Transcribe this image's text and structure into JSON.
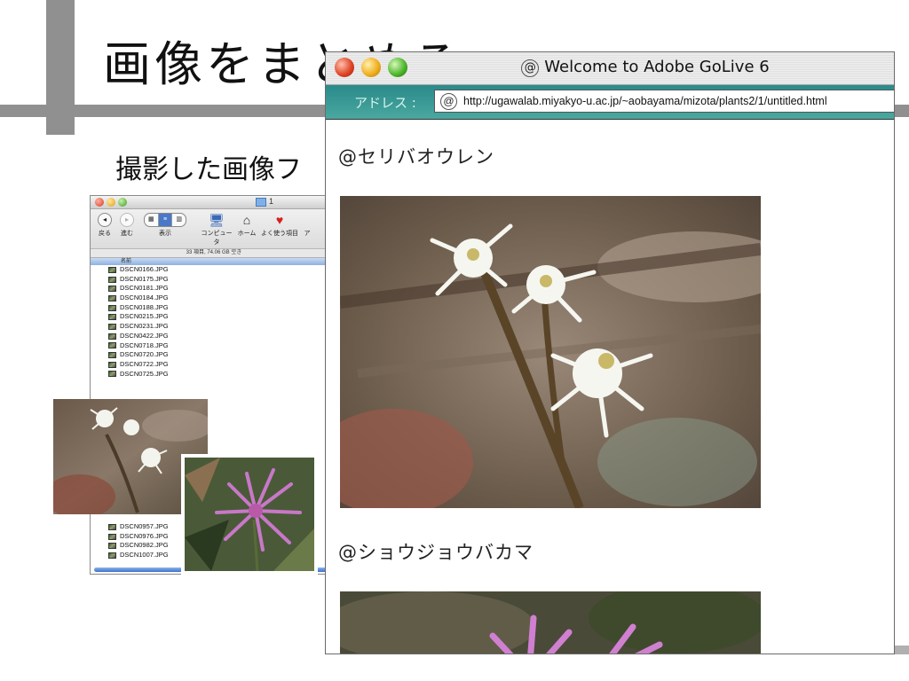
{
  "slide": {
    "title": "画像をまとめる",
    "subtitle": "撮影した画像フ"
  },
  "finder": {
    "title": "1",
    "toolbar": {
      "back": "戻る",
      "forward": "進む",
      "view": "表示",
      "computer": "コンピュータ",
      "home": "ホーム",
      "favorites": "よく使う項目",
      "applications": "ア"
    },
    "status": "33 項目, 74.06 GB 空き",
    "column_name": "名前",
    "files_top": [
      "DSCN0166.JPG",
      "DSCN0175.JPG",
      "DSCN0181.JPG",
      "DSCN0184.JPG",
      "DSCN0188.JPG",
      "DSCN0215.JPG",
      "DSCN0231.JPG",
      "DSCN0422.JPG",
      "DSCN0718.JPG",
      "DSCN0720.JPG",
      "DSCN0722.JPG",
      "DSCN0725.JPG"
    ],
    "files_bottom": [
      "DSCN0957.JPG",
      "DSCN0976.JPG",
      "DSCN0982.JPG",
      "DSCN1007.JPG"
    ]
  },
  "browser": {
    "title": "Welcome to Adobe GoLive 6",
    "address_label": "アドレス :",
    "url": "http://ugawalab.miyakyo-u.ac.jp/~aobayama/mizota/plants2/1/untitled.html",
    "heading1": "@セリバオウレン",
    "heading2": "@ショウジョウバカマ"
  },
  "colors": {
    "slide_bar": "#909090",
    "address_bar": "#2a8a8a",
    "traffic_red": "#e04828",
    "traffic_yellow": "#f0b020",
    "traffic_green": "#50b830"
  }
}
